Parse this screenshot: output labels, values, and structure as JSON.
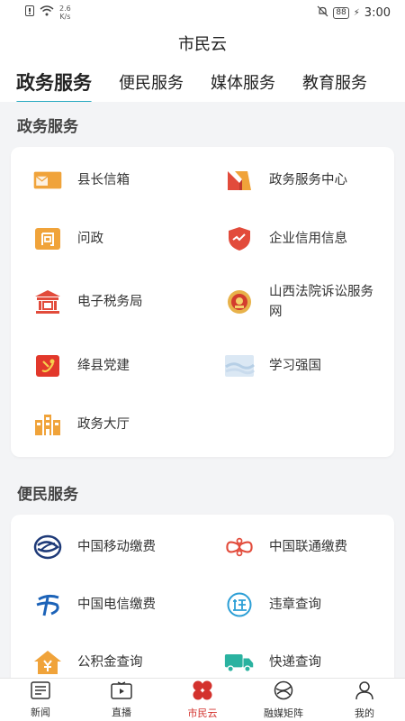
{
  "status_bar": {
    "net_speed_value": "2.6",
    "net_speed_unit": "K/s",
    "battery": "88",
    "time": "3:00"
  },
  "header": {
    "title": "市民云"
  },
  "tabs": [
    {
      "label": "政务服务",
      "active": true
    },
    {
      "label": "便民服务",
      "active": false
    },
    {
      "label": "媒体服务",
      "active": false
    },
    {
      "label": "教育服务",
      "active": false
    }
  ],
  "gov_section": {
    "title": "政务服务",
    "items": [
      {
        "label": "县长信箱",
        "icon": "mailbox-icon"
      },
      {
        "label": "政务服务中心",
        "icon": "gov-center-icon"
      },
      {
        "label": "问政",
        "icon": "inquiry-icon"
      },
      {
        "label": "企业信用信息",
        "icon": "credit-shield-icon"
      },
      {
        "label": "电子税务局",
        "icon": "tax-bureau-icon"
      },
      {
        "label": "山西法院诉讼服务网",
        "icon": "court-emblem-icon"
      },
      {
        "label": "绛县党建",
        "icon": "party-emblem-icon"
      },
      {
        "label": "学习强国",
        "icon": "xuexi-icon"
      },
      {
        "label": "政务大厅",
        "icon": "gov-hall-icon"
      }
    ]
  },
  "life_section": {
    "title": "便民服务",
    "items": [
      {
        "label": "中国移动缴费",
        "icon": "china-mobile-icon"
      },
      {
        "label": "中国联通缴费",
        "icon": "china-unicom-icon"
      },
      {
        "label": "中国电信缴费",
        "icon": "china-telecom-icon"
      },
      {
        "label": "违章查询",
        "icon": "violation-icon"
      },
      {
        "label": "公积金查询",
        "icon": "housing-fund-icon"
      },
      {
        "label": "快递查询",
        "icon": "delivery-truck-icon"
      }
    ]
  },
  "bottom_nav": [
    {
      "label": "新闻",
      "icon": "news-icon",
      "active": false
    },
    {
      "label": "直播",
      "icon": "live-tv-icon",
      "active": false
    },
    {
      "label": "市民云",
      "icon": "clover-icon",
      "active": true
    },
    {
      "label": "融媒矩阵",
      "icon": "media-matrix-icon",
      "active": false
    },
    {
      "label": "我的",
      "icon": "profile-icon",
      "active": false
    }
  ],
  "colors": {
    "accent": "#26a9c0",
    "nav_active": "#d3322d",
    "orange": "#f0a33a",
    "red": "#e24b3b"
  }
}
